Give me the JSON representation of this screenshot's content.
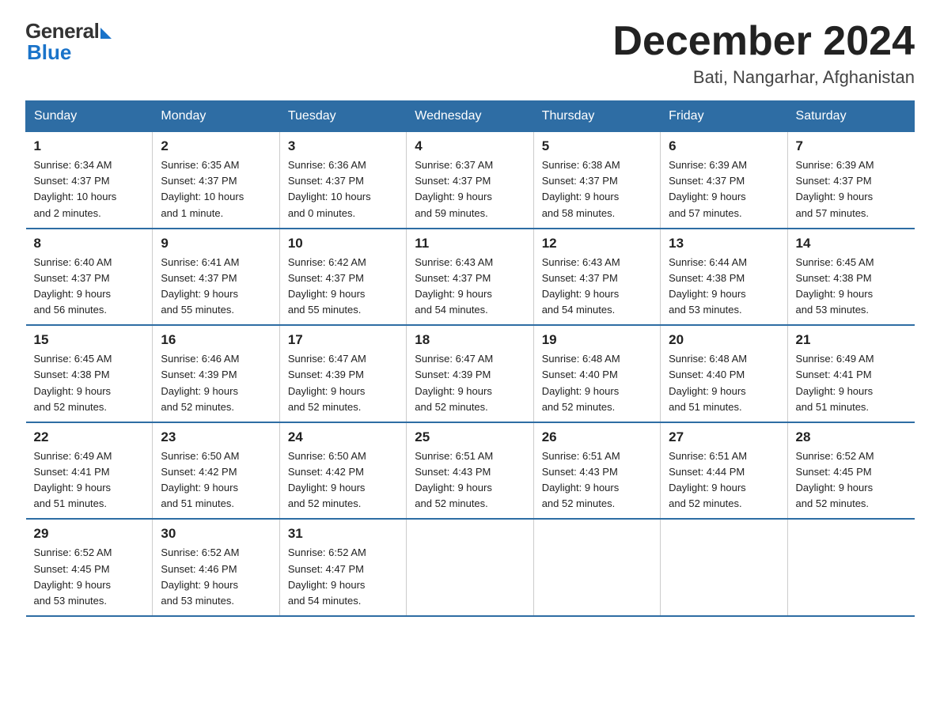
{
  "header": {
    "logo_general": "General",
    "logo_blue": "Blue",
    "month_title": "December 2024",
    "location": "Bati, Nangarhar, Afghanistan"
  },
  "weekdays": [
    "Sunday",
    "Monday",
    "Tuesday",
    "Wednesday",
    "Thursday",
    "Friday",
    "Saturday"
  ],
  "weeks": [
    [
      {
        "day": "1",
        "sunrise": "6:34 AM",
        "sunset": "4:37 PM",
        "daylight": "10 hours and 2 minutes."
      },
      {
        "day": "2",
        "sunrise": "6:35 AM",
        "sunset": "4:37 PM",
        "daylight": "10 hours and 1 minute."
      },
      {
        "day": "3",
        "sunrise": "6:36 AM",
        "sunset": "4:37 PM",
        "daylight": "10 hours and 0 minutes."
      },
      {
        "day": "4",
        "sunrise": "6:37 AM",
        "sunset": "4:37 PM",
        "daylight": "9 hours and 59 minutes."
      },
      {
        "day": "5",
        "sunrise": "6:38 AM",
        "sunset": "4:37 PM",
        "daylight": "9 hours and 58 minutes."
      },
      {
        "day": "6",
        "sunrise": "6:39 AM",
        "sunset": "4:37 PM",
        "daylight": "9 hours and 57 minutes."
      },
      {
        "day": "7",
        "sunrise": "6:39 AM",
        "sunset": "4:37 PM",
        "daylight": "9 hours and 57 minutes."
      }
    ],
    [
      {
        "day": "8",
        "sunrise": "6:40 AM",
        "sunset": "4:37 PM",
        "daylight": "9 hours and 56 minutes."
      },
      {
        "day": "9",
        "sunrise": "6:41 AM",
        "sunset": "4:37 PM",
        "daylight": "9 hours and 55 minutes."
      },
      {
        "day": "10",
        "sunrise": "6:42 AM",
        "sunset": "4:37 PM",
        "daylight": "9 hours and 55 minutes."
      },
      {
        "day": "11",
        "sunrise": "6:43 AM",
        "sunset": "4:37 PM",
        "daylight": "9 hours and 54 minutes."
      },
      {
        "day": "12",
        "sunrise": "6:43 AM",
        "sunset": "4:37 PM",
        "daylight": "9 hours and 54 minutes."
      },
      {
        "day": "13",
        "sunrise": "6:44 AM",
        "sunset": "4:38 PM",
        "daylight": "9 hours and 53 minutes."
      },
      {
        "day": "14",
        "sunrise": "6:45 AM",
        "sunset": "4:38 PM",
        "daylight": "9 hours and 53 minutes."
      }
    ],
    [
      {
        "day": "15",
        "sunrise": "6:45 AM",
        "sunset": "4:38 PM",
        "daylight": "9 hours and 52 minutes."
      },
      {
        "day": "16",
        "sunrise": "6:46 AM",
        "sunset": "4:39 PM",
        "daylight": "9 hours and 52 minutes."
      },
      {
        "day": "17",
        "sunrise": "6:47 AM",
        "sunset": "4:39 PM",
        "daylight": "9 hours and 52 minutes."
      },
      {
        "day": "18",
        "sunrise": "6:47 AM",
        "sunset": "4:39 PM",
        "daylight": "9 hours and 52 minutes."
      },
      {
        "day": "19",
        "sunrise": "6:48 AM",
        "sunset": "4:40 PM",
        "daylight": "9 hours and 52 minutes."
      },
      {
        "day": "20",
        "sunrise": "6:48 AM",
        "sunset": "4:40 PM",
        "daylight": "9 hours and 51 minutes."
      },
      {
        "day": "21",
        "sunrise": "6:49 AM",
        "sunset": "4:41 PM",
        "daylight": "9 hours and 51 minutes."
      }
    ],
    [
      {
        "day": "22",
        "sunrise": "6:49 AM",
        "sunset": "4:41 PM",
        "daylight": "9 hours and 51 minutes."
      },
      {
        "day": "23",
        "sunrise": "6:50 AM",
        "sunset": "4:42 PM",
        "daylight": "9 hours and 51 minutes."
      },
      {
        "day": "24",
        "sunrise": "6:50 AM",
        "sunset": "4:42 PM",
        "daylight": "9 hours and 52 minutes."
      },
      {
        "day": "25",
        "sunrise": "6:51 AM",
        "sunset": "4:43 PM",
        "daylight": "9 hours and 52 minutes."
      },
      {
        "day": "26",
        "sunrise": "6:51 AM",
        "sunset": "4:43 PM",
        "daylight": "9 hours and 52 minutes."
      },
      {
        "day": "27",
        "sunrise": "6:51 AM",
        "sunset": "4:44 PM",
        "daylight": "9 hours and 52 minutes."
      },
      {
        "day": "28",
        "sunrise": "6:52 AM",
        "sunset": "4:45 PM",
        "daylight": "9 hours and 52 minutes."
      }
    ],
    [
      {
        "day": "29",
        "sunrise": "6:52 AM",
        "sunset": "4:45 PM",
        "daylight": "9 hours and 53 minutes."
      },
      {
        "day": "30",
        "sunrise": "6:52 AM",
        "sunset": "4:46 PM",
        "daylight": "9 hours and 53 minutes."
      },
      {
        "day": "31",
        "sunrise": "6:52 AM",
        "sunset": "4:47 PM",
        "daylight": "9 hours and 54 minutes."
      },
      null,
      null,
      null,
      null
    ]
  ],
  "labels": {
    "sunrise": "Sunrise:",
    "sunset": "Sunset:",
    "daylight": "Daylight:"
  }
}
